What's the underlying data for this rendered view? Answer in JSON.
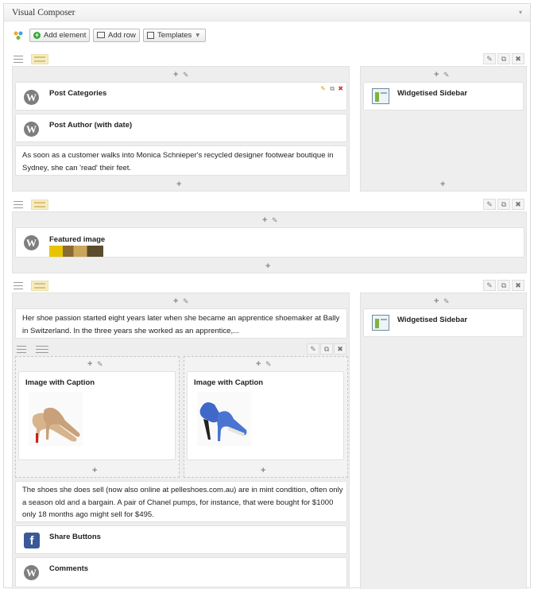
{
  "panel": {
    "title": "Visual Composer",
    "collapse_icon": "triangle-down-icon"
  },
  "toolbar": {
    "logo_icon": "vc-logo-icon",
    "add_element": "Add element",
    "add_row": "Add row",
    "templates": "Templates"
  },
  "icons": {
    "plus": "+",
    "pencil": "✎",
    "copy": "⧉",
    "delete": "✖",
    "edit": "✎",
    "arrow": "▾"
  },
  "rows": [
    {
      "left": [
        {
          "title": "Post Categories",
          "icon": "wordpress-icon"
        },
        {
          "title": "Post Author (with date)",
          "icon": "wordpress-icon"
        },
        {
          "text": "As soon as a customer walks into Monica Schnieper's recycled designer footwear boutique in Sydney, she can 'read' their feet."
        }
      ],
      "right": [
        {
          "title": "Widgetised Sidebar",
          "icon": "sidebar-widget-icon"
        }
      ]
    },
    {
      "full": [
        {
          "title": "Featured image",
          "icon": "wordpress-icon"
        }
      ]
    },
    {
      "left_text": "Her shoe passion started eight years later when she became an apprentice shoemaker at Bally in Switzerland. In the three years she worked as an apprentice,...",
      "inner": [
        {
          "title": "Image with Caption"
        },
        {
          "title": "Image with Caption"
        }
      ],
      "left_text2": "The shoes she does sell (now also online at pelleshoes.com.au) are in mint condition, often only a season old and a bargain. A pair of Chanel pumps, for instance, that were bought for $1000 only 18 months ago might sell for $495.",
      "share": {
        "title": "Share Buttons",
        "icon": "facebook-icon"
      },
      "comments": {
        "title": "Comments",
        "icon": "wordpress-icon"
      },
      "right": [
        {
          "title": "Widgetised Sidebar",
          "icon": "sidebar-widget-icon"
        }
      ]
    }
  ],
  "colors": {
    "accent_green": "#33aa33",
    "layout_yellow": "#f6ecc2",
    "facebook": "#3b5998"
  }
}
